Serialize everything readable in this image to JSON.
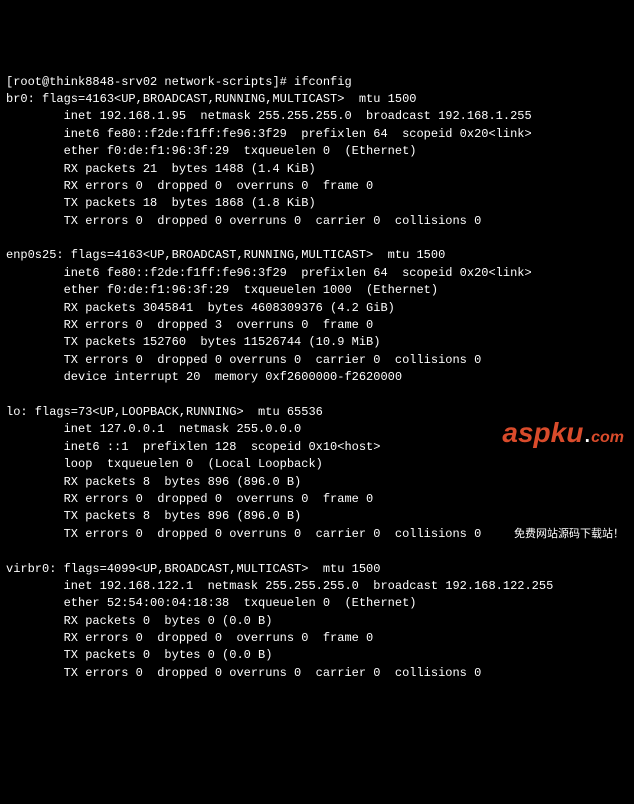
{
  "prompt": {
    "user": "root",
    "host": "think8848-srv02",
    "cwd": "network-scripts",
    "command": "ifconfig"
  },
  "interfaces": [
    {
      "name": "br0",
      "flags_num": 4163,
      "flags": "<UP,BROADCAST,RUNNING,MULTICAST>",
      "mtu": 1500,
      "lines": [
        "inet 192.168.1.95  netmask 255.255.255.0  broadcast 192.168.1.255",
        "inet6 fe80::f2de:f1ff:fe96:3f29  prefixlen 64  scopeid 0x20<link>",
        "ether f0:de:f1:96:3f:29  txqueuelen 0  (Ethernet)",
        "RX packets 21  bytes 1488 (1.4 KiB)",
        "RX errors 0  dropped 0  overruns 0  frame 0",
        "TX packets 18  bytes 1868 (1.8 KiB)",
        "TX errors 0  dropped 0 overruns 0  carrier 0  collisions 0"
      ]
    },
    {
      "name": "enp0s25",
      "flags_num": 4163,
      "flags": "<UP,BROADCAST,RUNNING,MULTICAST>",
      "mtu": 1500,
      "lines": [
        "inet6 fe80::f2de:f1ff:fe96:3f29  prefixlen 64  scopeid 0x20<link>",
        "ether f0:de:f1:96:3f:29  txqueuelen 1000  (Ethernet)",
        "RX packets 3045841  bytes 4608309376 (4.2 GiB)",
        "RX errors 0  dropped 3  overruns 0  frame 0",
        "TX packets 152760  bytes 11526744 (10.9 MiB)",
        "TX errors 0  dropped 0 overruns 0  carrier 0  collisions 0",
        "device interrupt 20  memory 0xf2600000-f2620000"
      ]
    },
    {
      "name": "lo",
      "flags_num": 73,
      "flags": "<UP,LOOPBACK,RUNNING>",
      "mtu": 65536,
      "lines": [
        "inet 127.0.0.1  netmask 255.0.0.0",
        "inet6 ::1  prefixlen 128  scopeid 0x10<host>",
        "loop  txqueuelen 0  (Local Loopback)",
        "RX packets 8  bytes 896 (896.0 B)",
        "RX errors 0  dropped 0  overruns 0  frame 0",
        "TX packets 8  bytes 896 (896.0 B)",
        "TX errors 0  dropped 0 overruns 0  carrier 0  collisions 0"
      ]
    },
    {
      "name": "virbr0",
      "flags_num": 4099,
      "flags": "<UP,BROADCAST,MULTICAST>",
      "mtu": 1500,
      "lines": [
        "inet 192.168.122.1  netmask 255.255.255.0  broadcast 192.168.122.255",
        "ether 52:54:00:04:18:38  txqueuelen 0  (Ethernet)",
        "RX packets 0  bytes 0 (0.0 B)",
        "RX errors 0  dropped 0  overruns 0  frame 0",
        "TX packets 0  bytes 0 (0.0 B)",
        "TX errors 0  dropped 0 overruns 0  carrier 0  collisions 0"
      ]
    }
  ],
  "watermark": {
    "brand_main": "aspku",
    "brand_tld": "com",
    "subtitle": "免费网站源码下载站！"
  }
}
